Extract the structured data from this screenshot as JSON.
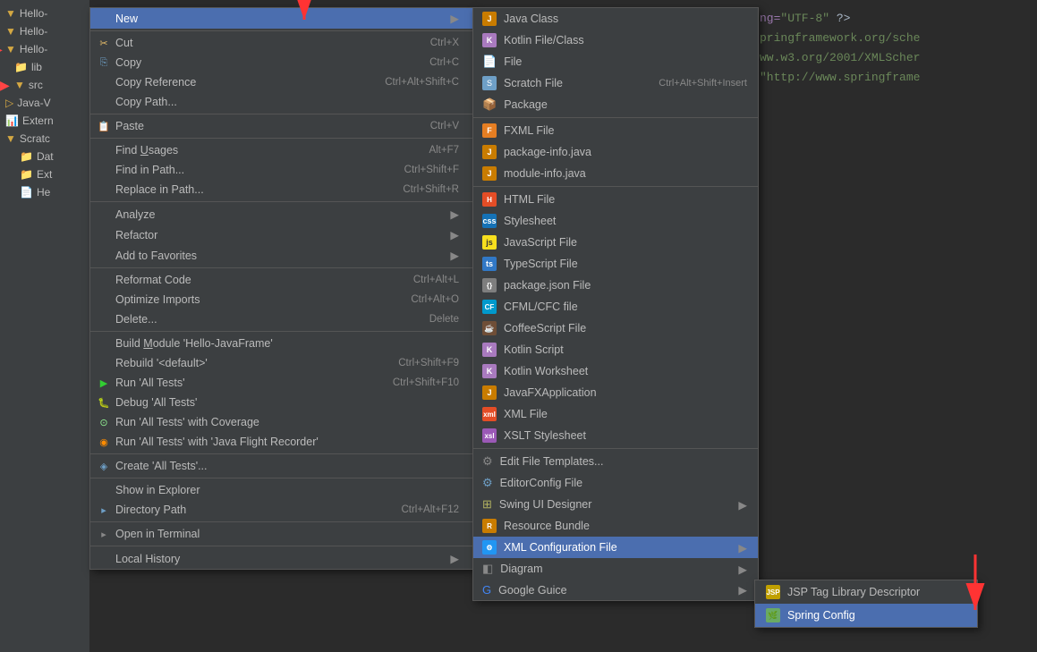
{
  "editor": {
    "lines": [
      {
        "text": "ng=\"UTF-8\" ?>"
      },
      {
        "text": "pringframework.org/sche"
      },
      {
        "text": "ww.w3.org/2001/XMLScher"
      },
      {
        "text": "\"http://www.springframe"
      }
    ]
  },
  "sidebar": {
    "items": [
      {
        "label": "Hello-",
        "type": "folder",
        "indent": 0
      },
      {
        "label": "Hello-",
        "type": "folder",
        "indent": 0
      },
      {
        "label": "Hello-",
        "type": "folder",
        "indent": 0
      },
      {
        "label": "lib",
        "type": "folder",
        "indent": 1
      },
      {
        "label": "src",
        "type": "folder-open",
        "indent": 1
      },
      {
        "label": "Java-V",
        "type": "folder",
        "indent": 0
      },
      {
        "label": "Extern",
        "type": "folder",
        "indent": 0
      },
      {
        "label": "Scratc",
        "type": "folder",
        "indent": 0
      },
      {
        "label": "Dat",
        "type": "folder",
        "indent": 2
      },
      {
        "label": "Ext",
        "type": "folder",
        "indent": 2
      }
    ]
  },
  "context_menu": {
    "items": [
      {
        "id": "new",
        "label": "New",
        "shortcut": "",
        "icon": "",
        "has_arrow": true,
        "highlighted": true,
        "separator_after": false
      },
      {
        "id": "separator1",
        "type": "separator"
      },
      {
        "id": "cut",
        "label": "Cut",
        "shortcut": "Ctrl+X",
        "icon": "cut",
        "has_arrow": false,
        "highlighted": false,
        "separator_after": false
      },
      {
        "id": "copy",
        "label": "Copy",
        "shortcut": "Ctrl+C",
        "icon": "copy",
        "has_arrow": false,
        "highlighted": false,
        "separator_after": false
      },
      {
        "id": "copy_reference",
        "label": "Copy Reference",
        "shortcut": "Ctrl+Alt+Shift+C",
        "icon": "",
        "has_arrow": false,
        "highlighted": false,
        "separator_after": false
      },
      {
        "id": "copy_path",
        "label": "Copy Path...",
        "shortcut": "",
        "icon": "",
        "has_arrow": false,
        "highlighted": false,
        "separator_after": false
      },
      {
        "id": "separator2",
        "type": "separator"
      },
      {
        "id": "paste",
        "label": "Paste",
        "shortcut": "Ctrl+V",
        "icon": "paste",
        "has_arrow": false,
        "highlighted": false,
        "separator_after": false
      },
      {
        "id": "separator3",
        "type": "separator"
      },
      {
        "id": "find_usages",
        "label": "Find Usages",
        "shortcut": "Alt+F7",
        "icon": "",
        "has_arrow": false,
        "highlighted": false,
        "separator_after": false
      },
      {
        "id": "find_in_path",
        "label": "Find in Path...",
        "shortcut": "Ctrl+Shift+F",
        "icon": "",
        "has_arrow": false,
        "highlighted": false,
        "separator_after": false
      },
      {
        "id": "replace_in_path",
        "label": "Replace in Path...",
        "shortcut": "Ctrl+Shift+R",
        "icon": "",
        "has_arrow": false,
        "highlighted": false,
        "separator_after": false
      },
      {
        "id": "separator4",
        "type": "separator"
      },
      {
        "id": "analyze",
        "label": "Analyze",
        "shortcut": "",
        "icon": "",
        "has_arrow": true,
        "highlighted": false,
        "separator_after": false
      },
      {
        "id": "refactor",
        "label": "Refactor",
        "shortcut": "",
        "icon": "",
        "has_arrow": true,
        "highlighted": false,
        "separator_after": false
      },
      {
        "id": "add_to_favorites",
        "label": "Add to Favorites",
        "shortcut": "",
        "icon": "",
        "has_arrow": true,
        "highlighted": false,
        "separator_after": false
      },
      {
        "id": "separator5",
        "type": "separator"
      },
      {
        "id": "reformat_code",
        "label": "Reformat Code",
        "shortcut": "Ctrl+Alt+L",
        "icon": "",
        "has_arrow": false,
        "highlighted": false,
        "separator_after": false
      },
      {
        "id": "optimize_imports",
        "label": "Optimize Imports",
        "shortcut": "Ctrl+Alt+O",
        "icon": "",
        "has_arrow": false,
        "highlighted": false,
        "separator_after": false
      },
      {
        "id": "delete",
        "label": "Delete...",
        "shortcut": "Delete",
        "icon": "",
        "has_arrow": false,
        "highlighted": false,
        "separator_after": false
      },
      {
        "id": "separator6",
        "type": "separator"
      },
      {
        "id": "build_module",
        "label": "Build Module 'Hello-JavaFrame'",
        "shortcut": "",
        "icon": "",
        "has_arrow": false,
        "highlighted": false,
        "separator_after": false
      },
      {
        "id": "rebuild",
        "label": "Rebuild '<default>'",
        "shortcut": "Ctrl+Shift+F9",
        "icon": "",
        "has_arrow": false,
        "highlighted": false,
        "separator_after": false
      },
      {
        "id": "run_all_tests",
        "label": "Run 'All Tests'",
        "shortcut": "Ctrl+Shift+F10",
        "icon": "run",
        "has_arrow": false,
        "highlighted": false,
        "separator_after": false
      },
      {
        "id": "debug_all_tests",
        "label": "Debug 'All Tests'",
        "shortcut": "",
        "icon": "debug",
        "has_arrow": false,
        "highlighted": false,
        "separator_after": false
      },
      {
        "id": "run_coverage",
        "label": "Run 'All Tests' with Coverage",
        "shortcut": "",
        "icon": "coverage",
        "has_arrow": false,
        "highlighted": false,
        "separator_after": false
      },
      {
        "id": "run_flight",
        "label": "Run 'All Tests' with 'Java Flight Recorder'",
        "shortcut": "",
        "icon": "flight",
        "has_arrow": false,
        "highlighted": false,
        "separator_after": false
      },
      {
        "id": "separator7",
        "type": "separator"
      },
      {
        "id": "create_tests",
        "label": "Create 'All Tests'...",
        "shortcut": "",
        "icon": "create",
        "has_arrow": false,
        "highlighted": false,
        "separator_after": false
      },
      {
        "id": "separator8",
        "type": "separator"
      },
      {
        "id": "show_explorer",
        "label": "Show in Explorer",
        "shortcut": "",
        "icon": "",
        "has_arrow": false,
        "highlighted": false,
        "separator_after": false
      },
      {
        "id": "directory_path",
        "label": "Directory Path",
        "shortcut": "Ctrl+Alt+F12",
        "icon": "",
        "has_arrow": false,
        "highlighted": false,
        "separator_after": false
      },
      {
        "id": "separator9",
        "type": "separator"
      },
      {
        "id": "open_terminal",
        "label": "Open in Terminal",
        "shortcut": "",
        "icon": "terminal",
        "has_arrow": false,
        "highlighted": false,
        "separator_after": false
      },
      {
        "id": "separator10",
        "type": "separator"
      },
      {
        "id": "local_history",
        "label": "Local History",
        "shortcut": "",
        "icon": "",
        "has_arrow": true,
        "highlighted": false,
        "separator_after": false
      }
    ]
  },
  "submenu_new": {
    "items": [
      {
        "id": "java_class",
        "label": "Java Class",
        "icon": "java",
        "shortcut": "",
        "has_arrow": false
      },
      {
        "id": "kotlin_class",
        "label": "Kotlin File/Class",
        "icon": "kotlin",
        "shortcut": "",
        "has_arrow": false
      },
      {
        "id": "file",
        "label": "File",
        "icon": "file",
        "shortcut": "",
        "has_arrow": false
      },
      {
        "id": "scratch_file",
        "label": "Scratch File",
        "shortcut": "Ctrl+Alt+Shift+Insert",
        "icon": "scratch",
        "has_arrow": false
      },
      {
        "id": "package",
        "label": "Package",
        "icon": "package",
        "shortcut": "",
        "has_arrow": false
      },
      {
        "id": "separator1",
        "type": "separator"
      },
      {
        "id": "fxml_file",
        "label": "FXML File",
        "icon": "fxml",
        "shortcut": "",
        "has_arrow": false
      },
      {
        "id": "package_info",
        "label": "package-info.java",
        "icon": "java",
        "shortcut": "",
        "has_arrow": false
      },
      {
        "id": "module_info",
        "label": "module-info.java",
        "icon": "java",
        "shortcut": "",
        "has_arrow": false
      },
      {
        "id": "separator2",
        "type": "separator"
      },
      {
        "id": "html_file",
        "label": "HTML File",
        "icon": "html",
        "shortcut": "",
        "has_arrow": false
      },
      {
        "id": "stylesheet",
        "label": "Stylesheet",
        "icon": "css",
        "shortcut": "",
        "has_arrow": false
      },
      {
        "id": "js_file",
        "label": "JavaScript File",
        "icon": "js",
        "shortcut": "",
        "has_arrow": false
      },
      {
        "id": "ts_file",
        "label": "TypeScript File",
        "icon": "ts",
        "shortcut": "",
        "has_arrow": false
      },
      {
        "id": "json_file",
        "label": "package.json File",
        "icon": "json",
        "shortcut": "",
        "has_arrow": false
      },
      {
        "id": "cfml_file",
        "label": "CFML/CFC file",
        "icon": "cf",
        "shortcut": "",
        "has_arrow": false
      },
      {
        "id": "coffee_file",
        "label": "CoffeeScript File",
        "icon": "coffee",
        "shortcut": "",
        "has_arrow": false
      },
      {
        "id": "kotlin_script",
        "label": "Kotlin Script",
        "icon": "kotlin",
        "shortcut": "",
        "has_arrow": false
      },
      {
        "id": "kotlin_worksheet",
        "label": "Kotlin Worksheet",
        "icon": "kotlin",
        "shortcut": "",
        "has_arrow": false
      },
      {
        "id": "javafx_app",
        "label": "JavaFXApplication",
        "icon": "java",
        "shortcut": "",
        "has_arrow": false
      },
      {
        "id": "xml_file",
        "label": "XML File",
        "icon": "xml",
        "shortcut": "",
        "has_arrow": false
      },
      {
        "id": "xslt_stylesheet",
        "label": "XSLT Stylesheet",
        "icon": "xslt",
        "shortcut": "",
        "has_arrow": false
      },
      {
        "id": "separator3",
        "type": "separator"
      },
      {
        "id": "edit_file_templates",
        "label": "Edit File Templates...",
        "icon": "gear",
        "shortcut": "",
        "has_arrow": false
      },
      {
        "id": "editorconfig_file",
        "label": "EditorConfig File",
        "icon": "editor",
        "shortcut": "",
        "has_arrow": false
      },
      {
        "id": "swing_designer",
        "label": "Swing UI Designer",
        "icon": "swing",
        "shortcut": "",
        "has_arrow": true
      },
      {
        "id": "resource_bundle",
        "label": "Resource Bundle",
        "icon": "bundle",
        "shortcut": "",
        "has_arrow": false
      },
      {
        "id": "xml_config",
        "label": "XML Configuration File",
        "icon": "xml_config",
        "shortcut": "",
        "has_arrow": true,
        "highlighted": true
      },
      {
        "id": "diagram",
        "label": "Diagram",
        "icon": "diagram",
        "shortcut": "",
        "has_arrow": true
      },
      {
        "id": "google_guice",
        "label": "Google Guice",
        "icon": "google",
        "shortcut": "",
        "has_arrow": true
      }
    ]
  },
  "submenu_xml": {
    "items": [
      {
        "id": "jsp_tag",
        "label": "JSP Tag Library Descriptor",
        "icon": "xml_config",
        "highlighted": false
      },
      {
        "id": "spring_config",
        "label": "Spring Config",
        "icon": "spring",
        "highlighted": true
      }
    ]
  },
  "labels": {
    "new": "New",
    "cut": "Cut",
    "copy": "Copy",
    "copy_reference": "Copy Reference",
    "copy_path": "Copy Path...",
    "paste": "Paste",
    "find_usages": "Find Usages",
    "find_in_path": "Find in Path...",
    "replace_in_path": "Replace in Path...",
    "analyze": "Analyze",
    "refactor": "Refactor",
    "add_favorites": "Add to Favorites",
    "reformat_code": "Reformat Code",
    "optimize_imports": "Optimize Imports",
    "delete": "Delete...",
    "build_module": "Build Module 'Hello-JavaFrame'",
    "rebuild": "Rebuild '<default>'",
    "run_all_tests": "Run 'All Tests'",
    "debug_all_tests": "Debug 'All Tests'",
    "run_coverage": "Run 'All Tests' with Coverage",
    "run_flight": "Run 'All Tests' with 'Java Flight Recorder'",
    "create_tests": "Create 'All Tests'...",
    "show_explorer": "Show in Explorer",
    "directory_path": "Directory Path",
    "open_terminal": "Open in Terminal",
    "local_history": "Local History"
  }
}
